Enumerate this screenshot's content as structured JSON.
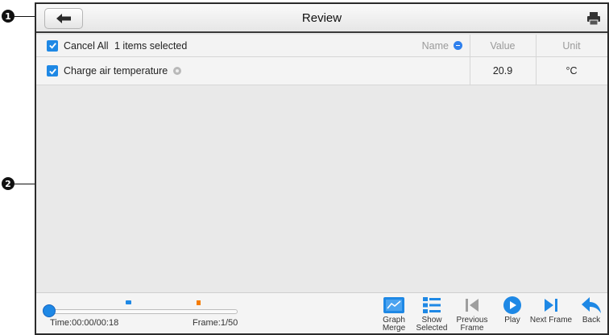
{
  "callouts": {
    "first": "1",
    "second": "2"
  },
  "header": {
    "title": "Review",
    "back_icon": "back-arrow-icon",
    "print_icon": "printer-icon"
  },
  "table": {
    "select_label": "Cancel All",
    "selected_count": "1 items selected",
    "columns": {
      "name": "Name",
      "value": "Value",
      "unit": "Unit"
    },
    "rows": [
      {
        "name": "Charge air temperature",
        "value": "20.9",
        "unit": "°C",
        "checked": true
      }
    ]
  },
  "playback": {
    "time": "Time:00:00/00:18",
    "frame": "Frame:1/50"
  },
  "toolbar": {
    "graph_merge": "Graph Merge",
    "show_selected": "Show Selected",
    "previous_frame": "Previous Frame",
    "play": "Play",
    "next_frame": "Next Frame",
    "back": "Back"
  },
  "colors": {
    "accent": "#1E88E5",
    "marker_flag": "#F57C00"
  }
}
